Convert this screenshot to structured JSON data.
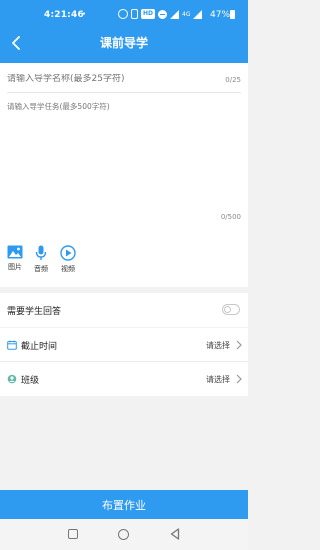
{
  "status_bar": {
    "time": "4:21:46",
    "dot": "•",
    "hd_badge": "HD",
    "network": "4G",
    "battery": "47%"
  },
  "header": {
    "title": "课前导学",
    "back_icon": "chevron-left-icon"
  },
  "form": {
    "name_placeholder": "请输入导学名称(最多25字符)",
    "name_counter": "0/25",
    "task_placeholder": "请输入导学任务(最多500字符)",
    "task_counter": "0/500",
    "media": [
      {
        "label": "图片",
        "icon": "image-icon"
      },
      {
        "label": "音频",
        "icon": "microphone-icon"
      },
      {
        "label": "视频",
        "icon": "play-icon"
      }
    ]
  },
  "settings": {
    "reply_label": "需要学生回答",
    "reply_enabled": false,
    "deadline_label": "截止时间",
    "deadline_value": "请选择",
    "class_label": "班级",
    "class_value": "请选择"
  },
  "submit_label": "布置作业",
  "colors": {
    "primary": "#2f9bf0",
    "background": "#f2f2f2"
  }
}
